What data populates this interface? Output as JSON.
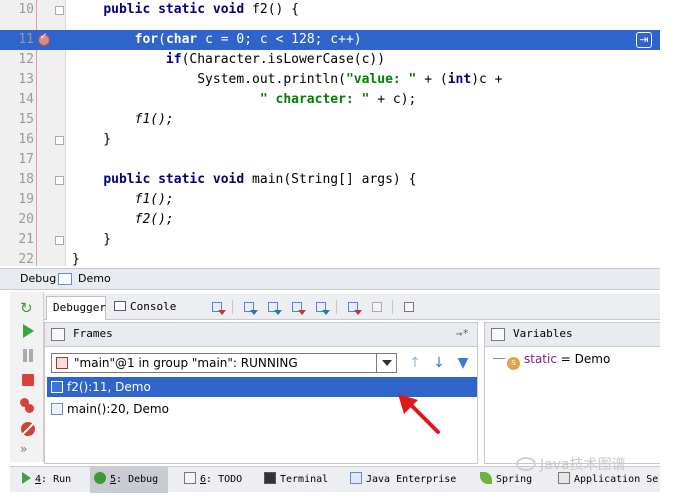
{
  "editor": {
    "lines": [
      {
        "num": "10",
        "code": "    public static void f2() {"
      },
      {
        "num": "11",
        "code": "        for(char c = 0; c < 128; c++)"
      },
      {
        "num": "12",
        "code": "            if(Character.isLowerCase(c))"
      },
      {
        "num": "13",
        "code": "                System.out.println(\"value: \" + (int)c +"
      },
      {
        "num": "14",
        "code": "                        \" character: \" + c);"
      },
      {
        "num": "15",
        "code": "        f1();"
      },
      {
        "num": "16",
        "code": "    }"
      },
      {
        "num": "17",
        "code": ""
      },
      {
        "num": "18",
        "code": "    public static void main(String[] args) {"
      },
      {
        "num": "19",
        "code": "        f1();"
      },
      {
        "num": "20",
        "code": "        f2();"
      },
      {
        "num": "21",
        "code": "    }"
      },
      {
        "num": "22",
        "code": "}"
      }
    ],
    "highlighted_line": "11"
  },
  "debug_title": {
    "label": "Debug",
    "config": "Demo"
  },
  "tabs": {
    "debugger": "Debugger",
    "console": "Console →*"
  },
  "frames": {
    "title": "Frames",
    "pin": "→*",
    "thread": "\"main\"@1 in group \"main\": RUNNING",
    "rows": [
      {
        "label": "f2():11, Demo",
        "selected": true
      },
      {
        "label": "main():20, Demo",
        "selected": false
      }
    ]
  },
  "variables": {
    "title": "Variables",
    "items": [
      {
        "badge": "s",
        "name": "static",
        "value": " = Demo"
      }
    ]
  },
  "bottombar": {
    "items": [
      {
        "key": "4",
        "label": ": Run"
      },
      {
        "key": "5",
        "label": ": Debug"
      },
      {
        "key": "6",
        "label": ": TODO"
      },
      {
        "key": "",
        "label": "Terminal"
      },
      {
        "key": "",
        "label": "Java Enterprise"
      },
      {
        "key": "",
        "label": "Spring"
      },
      {
        "key": "",
        "label": "Application Se"
      }
    ]
  },
  "watermark": {
    "text": "Java技术图谱"
  },
  "colors": {
    "selection": "#2f65ca",
    "keyword": "#000080",
    "string": "#008000"
  }
}
